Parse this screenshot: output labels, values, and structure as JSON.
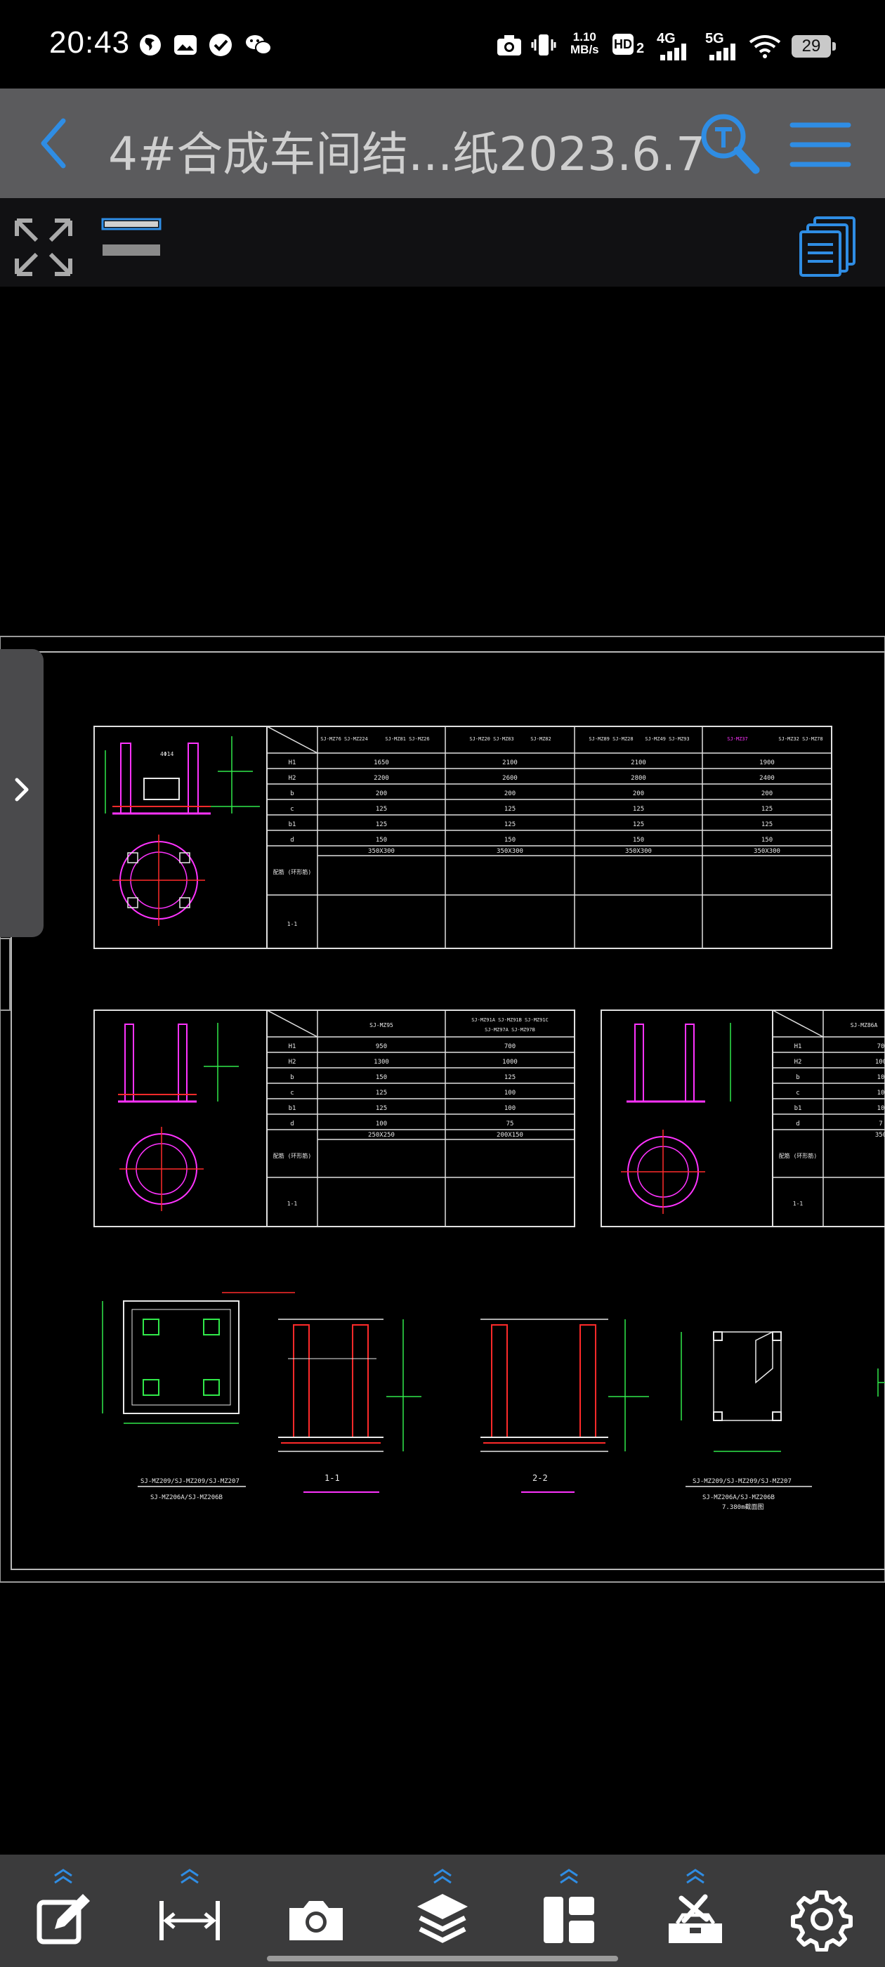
{
  "status_bar": {
    "time": "20:43",
    "net_speed_value": "1.10",
    "net_speed_unit": "MB/s",
    "hd_label": "HD",
    "hd_sub": "2",
    "net_4g": "4G",
    "net_5g": "5G",
    "battery": "29"
  },
  "title_bar": {
    "title": "4#合成车间结...纸2023.6.7"
  },
  "drawing": {
    "section_labels": [
      "1-1",
      "2-2"
    ],
    "plan_label": "SJ-MZ209/SJ-MZ209/SJ-MZ207",
    "plan_sublabel": "SJ-MZ206A/SJ-MZ206B",
    "detail_label": "SJ-MZ209/SJ-MZ209/SJ-MZ207",
    "detail_sublabel": "SJ-MZ206A/SJ-MZ206B",
    "detail_note": "7.380m截面图",
    "table1_headers": [
      "SJ-MZ76 SJ-MZ224",
      "SJ-MZ81 SJ-MZ26",
      "SJ-MZ89 SJ-MZ24",
      "SJ-MZ222 SJ-MZ75",
      "SJ-MZ20",
      "SJ-MZ83",
      "SJ-MZ82",
      "SJ-MZ89 SJ-MZ28",
      "SJ-MZ49",
      "SJ-MZ93",
      "SJ-MZ37",
      "SJ-MZ32",
      "SJ-MZ78"
    ],
    "table1_rows": [
      {
        "label": "H1",
        "values": [
          "1650",
          "2100",
          "2100",
          "1900"
        ]
      },
      {
        "label": "H2",
        "values": [
          "2200",
          "2600",
          "2800",
          "2400"
        ]
      },
      {
        "label": "b",
        "values": [
          "200",
          "200",
          "200",
          "200"
        ]
      },
      {
        "label": "c",
        "values": [
          "125",
          "125",
          "125",
          "125"
        ]
      },
      {
        "label": "b1",
        "values": [
          "125",
          "125",
          "125",
          "125"
        ]
      },
      {
        "label": "d",
        "values": [
          "150",
          "150",
          "150",
          "150"
        ]
      }
    ],
    "table1_section_values": [
      "350X300",
      "350X300",
      "350X300",
      "350X300"
    ],
    "table2_headers": [
      "SJ-MZ95",
      "SJ-MZ91A SJ-MZ91B SJ-MZ91C",
      "SJ-MZ97A SJ-MZ97B"
    ],
    "table2_rows": [
      {
        "label": "H1",
        "values": [
          "950",
          "700"
        ]
      },
      {
        "label": "H2",
        "values": [
          "1300",
          "1000"
        ]
      },
      {
        "label": "b",
        "values": [
          "150",
          "125"
        ]
      },
      {
        "label": "c",
        "values": [
          "125",
          "100"
        ]
      },
      {
        "label": "b1",
        "values": [
          "125",
          "100"
        ]
      },
      {
        "label": "d",
        "values": [
          "100",
          "75"
        ]
      }
    ],
    "table2_section_values": [
      "250X250",
      "200X150"
    ],
    "table3_headers": [
      "SJ-MZ86A"
    ],
    "table3_rows": [
      {
        "label": "H1",
        "values": [
          "70"
        ]
      },
      {
        "label": "H2",
        "values": [
          "100"
        ]
      },
      {
        "label": "b",
        "values": [
          "10"
        ]
      },
      {
        "label": "c",
        "values": [
          "10"
        ]
      },
      {
        "label": "b1",
        "values": [
          "10"
        ]
      },
      {
        "label": "d",
        "values": [
          "7"
        ]
      }
    ],
    "table3_section_values": [
      "350"
    ],
    "row_labels_extra": [
      "配筋 (环形筋)",
      "1-1"
    ]
  },
  "bottom_bar": {
    "items": [
      "edit-icon",
      "measure-icon",
      "camera-icon",
      "layers-icon",
      "layout-icon",
      "tools-icon",
      "settings-icon"
    ]
  },
  "colors": {
    "accent": "#2f8de4",
    "title_bar": "#5b5b5d",
    "toolbar": "#111113",
    "bottom_bar": "#3b3b3c",
    "cad_white": "#e8e8e8",
    "cad_red": "#ff2a2a",
    "cad_green": "#31e84a",
    "cad_magenta": "#ff33ff",
    "cad_yellow": "#ffff55"
  }
}
